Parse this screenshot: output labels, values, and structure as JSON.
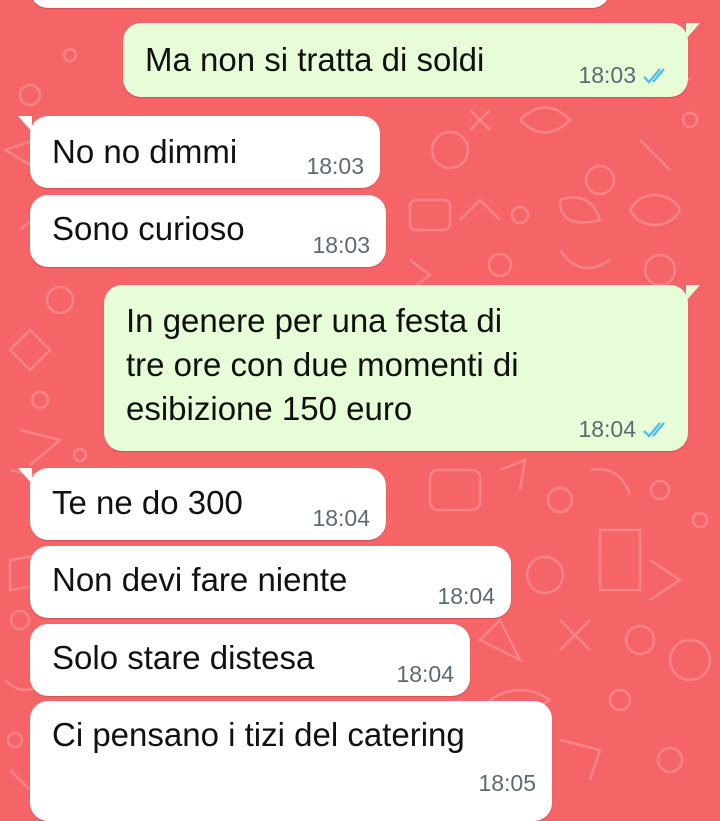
{
  "colors": {
    "background": "#f56466",
    "incoming_bubble": "#ffffff",
    "outgoing_bubble": "#e7fdd8",
    "read_ticks": "#53bdeb",
    "time_text": "#5c6a73"
  },
  "messages": [
    {
      "direction": "outgoing",
      "text": "Ma non si tratta di soldi",
      "time": "18:03",
      "status_icon": "double-check-read-icon"
    },
    {
      "direction": "incoming",
      "text": "No no dimmi",
      "time": "18:03"
    },
    {
      "direction": "incoming",
      "text": "Sono curioso",
      "time": "18:03"
    },
    {
      "direction": "outgoing",
      "text": "In genere per una festa di\ntre ore con due momenti di\nesibizione 150 euro",
      "time": "18:04",
      "status_icon": "double-check-read-icon"
    },
    {
      "direction": "incoming",
      "text": "Te ne do 300",
      "time": "18:04"
    },
    {
      "direction": "incoming",
      "text": "Non devi fare niente",
      "time": "18:04"
    },
    {
      "direction": "incoming",
      "text": "Solo stare distesa",
      "time": "18:04"
    },
    {
      "direction": "incoming",
      "text": "Ci pensano i tizi del catering",
      "time": "18:05"
    }
  ]
}
